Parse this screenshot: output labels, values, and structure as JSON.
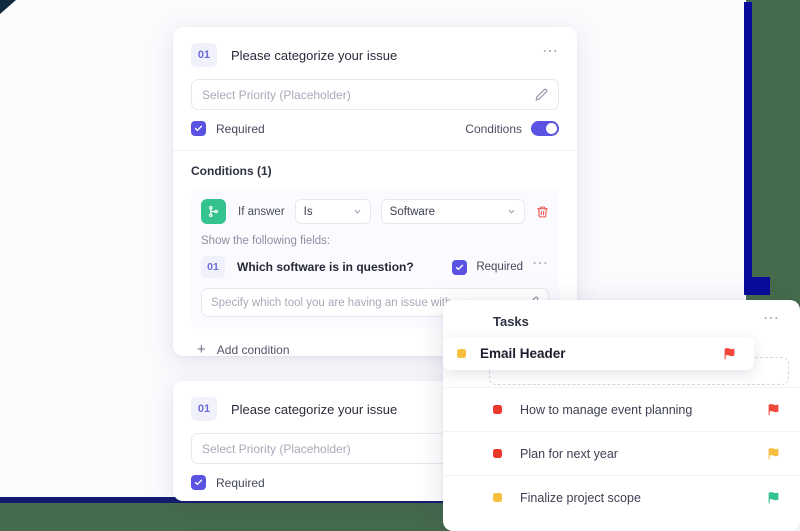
{
  "theme": {
    "accent": "#5a52e0",
    "navy": "#0a0a9c",
    "olive": "#466b4c",
    "green": "#34c28f",
    "red": "#e8443a",
    "yellow": "#f7bf3f"
  },
  "form_card": {
    "number": "01",
    "title": "Please categorize your issue",
    "more_icon": "ellipsis-icon",
    "input": {
      "placeholder": "Select Priority (Placeholder)",
      "value": "",
      "edit_icon": "pencil-icon"
    },
    "required_label": "Required",
    "required_checked": true,
    "conditions_label": "Conditions",
    "conditions_enabled": true,
    "conditions_header": "Conditions (1)",
    "condition": {
      "branch_icon": "branch-icon",
      "if_label": "If answer",
      "operator": "Is",
      "value": "Software",
      "delete_icon": "trash-icon",
      "chevron_icon": "chevron-down-icon",
      "show_fields_label": "Show the following fields:",
      "sub_question": {
        "number": "01",
        "title": "Which software is in question?",
        "required_label": "Required",
        "required_checked": true,
        "more_icon": "ellipsis-icon",
        "input": {
          "placeholder": "Specify which tool you are having an issue with",
          "value": "",
          "edit_icon": "pencil-icon"
        }
      }
    },
    "add_condition_label": "Add condition",
    "add_icon": "plus-icon"
  },
  "form_card_2": {
    "number": "01",
    "title": "Please categorize your issue",
    "input": {
      "placeholder": "Select Priority (Placeholder)",
      "value": "",
      "edit_icon": "pencil-icon"
    },
    "required_label": "Required",
    "required_checked": true
  },
  "tasks_panel": {
    "title": "Tasks",
    "more_icon": "ellipsis-icon",
    "dragging_task": {
      "name": "Email Header",
      "dot_color": "#f7bf3f",
      "flag_color": "#f2483c",
      "flag_icon": "flag-icon"
    },
    "rows": [
      {
        "name": "How to manage event planning",
        "dot_color": "#e8392c",
        "flag_color": "#f2483c",
        "flag_icon": "flag-icon"
      },
      {
        "name": "Plan for next year",
        "dot_color": "#e8392c",
        "flag_color": "#f7bf3f",
        "flag_icon": "flag-icon"
      },
      {
        "name": "Finalize project scope",
        "dot_color": "#f7bf3f",
        "flag_color": "#34c28f",
        "flag_icon": "flag-icon"
      }
    ]
  }
}
